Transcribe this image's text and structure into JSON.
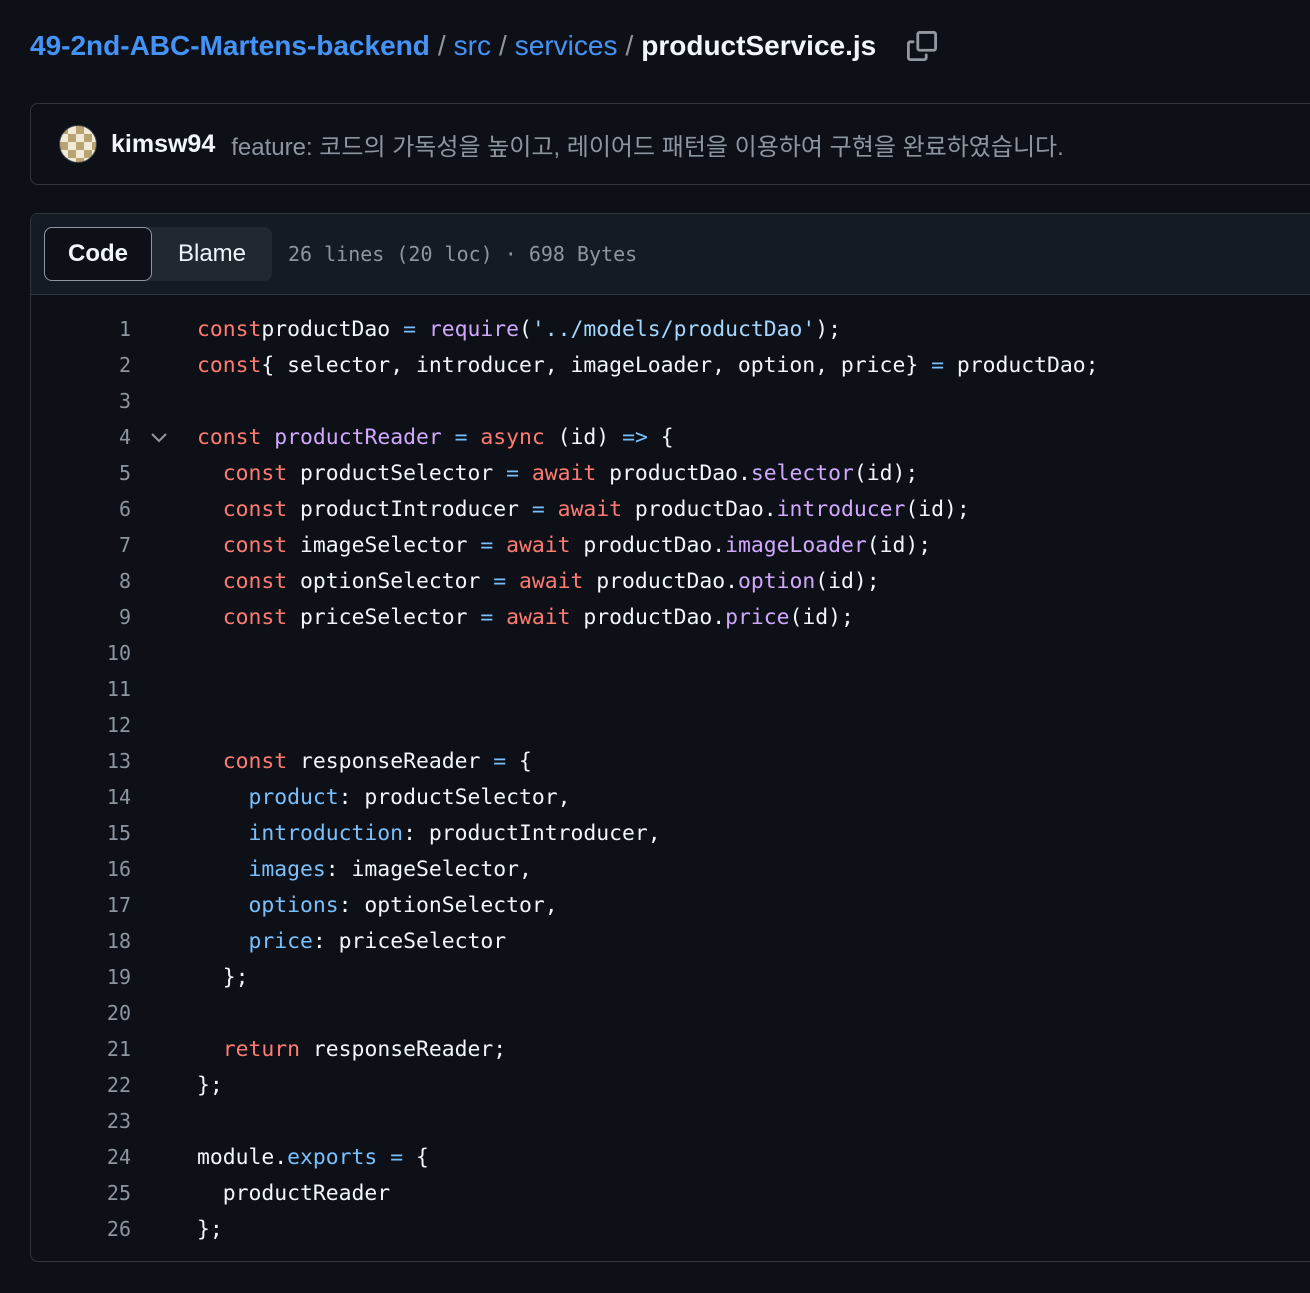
{
  "breadcrumb": {
    "repo": "49-2nd-ABC-Martens-backend",
    "separator": "/",
    "dir1": "src",
    "dir2": "services",
    "file": "productService.js"
  },
  "icons": {
    "copy": "copy-icon",
    "fold": "chevron-down-icon",
    "avatar": "avatar"
  },
  "commit": {
    "author": "kimsw94",
    "message": "feature: 코드의 가독성을 높이고, 레이어드 패턴을 이용하여 구현을 완료하였습니다."
  },
  "file": {
    "tabs": [
      {
        "label": "Code",
        "active": true
      },
      {
        "label": "Blame",
        "active": false
      }
    ],
    "meta": "26 lines (20 loc) · 698 Bytes"
  },
  "colors": {
    "background": "#0d1117",
    "link": "#4493f8",
    "keyword": "#ff7b72",
    "function": "#d2a8ff",
    "constant": "#79c0ff",
    "string": "#a5d6ff"
  },
  "code": {
    "line_numbers": [
      "1",
      "2",
      "3",
      "4",
      "5",
      "6",
      "7",
      "8",
      "9",
      "10",
      "11",
      "12",
      "13",
      "14",
      "15",
      "16",
      "17",
      "18",
      "19",
      "20",
      "21",
      "22",
      "23",
      "24",
      "25",
      "26"
    ],
    "lines": [
      [
        [
          "kw",
          "const"
        ],
        [
          "",
          "productDao "
        ],
        [
          "cn",
          "="
        ],
        [
          "",
          " "
        ],
        [
          "fn",
          "require"
        ],
        [
          "",
          "("
        ],
        [
          "st",
          "'../models/productDao'"
        ],
        [
          "",
          ");"
        ]
      ],
      [
        [
          "kw",
          "const"
        ],
        [
          "",
          "{ selector, introducer, imageLoader, option, price} "
        ],
        [
          "cn",
          "="
        ],
        [
          "",
          " productDao;"
        ]
      ],
      [],
      [
        [
          "kw",
          "const"
        ],
        [
          "",
          " "
        ],
        [
          "fn",
          "productReader"
        ],
        [
          "",
          " "
        ],
        [
          "cn",
          "="
        ],
        [
          "",
          " "
        ],
        [
          "kw",
          "async"
        ],
        [
          "",
          " (id) "
        ],
        [
          "cn",
          "=>"
        ],
        [
          "",
          " {"
        ]
      ],
      [
        [
          "",
          "  "
        ],
        [
          "kw",
          "const"
        ],
        [
          "",
          " productSelector "
        ],
        [
          "cn",
          "="
        ],
        [
          "",
          " "
        ],
        [
          "kw",
          "await"
        ],
        [
          "",
          " productDao."
        ],
        [
          "fn",
          "selector"
        ],
        [
          "",
          "(id);"
        ]
      ],
      [
        [
          "",
          "  "
        ],
        [
          "kw",
          "const"
        ],
        [
          "",
          " productIntroducer "
        ],
        [
          "cn",
          "="
        ],
        [
          "",
          " "
        ],
        [
          "kw",
          "await"
        ],
        [
          "",
          " productDao."
        ],
        [
          "fn",
          "introducer"
        ],
        [
          "",
          "(id);"
        ]
      ],
      [
        [
          "",
          "  "
        ],
        [
          "kw",
          "const"
        ],
        [
          "",
          " imageSelector "
        ],
        [
          "cn",
          "="
        ],
        [
          "",
          " "
        ],
        [
          "kw",
          "await"
        ],
        [
          "",
          " productDao."
        ],
        [
          "fn",
          "imageLoader"
        ],
        [
          "",
          "(id);"
        ]
      ],
      [
        [
          "",
          "  "
        ],
        [
          "kw",
          "const"
        ],
        [
          "",
          " optionSelector "
        ],
        [
          "cn",
          "="
        ],
        [
          "",
          " "
        ],
        [
          "kw",
          "await"
        ],
        [
          "",
          " productDao."
        ],
        [
          "fn",
          "option"
        ],
        [
          "",
          "(id);"
        ]
      ],
      [
        [
          "",
          "  "
        ],
        [
          "kw",
          "const"
        ],
        [
          "",
          " priceSelector "
        ],
        [
          "cn",
          "="
        ],
        [
          "",
          " "
        ],
        [
          "kw",
          "await"
        ],
        [
          "",
          " productDao."
        ],
        [
          "fn",
          "price"
        ],
        [
          "",
          "(id);"
        ]
      ],
      [],
      [],
      [],
      [
        [
          "",
          "  "
        ],
        [
          "kw",
          "const"
        ],
        [
          "",
          " responseReader "
        ],
        [
          "cn",
          "="
        ],
        [
          "",
          " {"
        ]
      ],
      [
        [
          "",
          "    "
        ],
        [
          "cn",
          "product"
        ],
        [
          "",
          ": productSelector,"
        ]
      ],
      [
        [
          "",
          "    "
        ],
        [
          "cn",
          "introduction"
        ],
        [
          "",
          ": productIntroducer,"
        ]
      ],
      [
        [
          "",
          "    "
        ],
        [
          "cn",
          "images"
        ],
        [
          "",
          ": imageSelector,"
        ]
      ],
      [
        [
          "",
          "    "
        ],
        [
          "cn",
          "options"
        ],
        [
          "",
          ": optionSelector,"
        ]
      ],
      [
        [
          "",
          "    "
        ],
        [
          "cn",
          "price"
        ],
        [
          "",
          ": priceSelector"
        ]
      ],
      [
        [
          "",
          "  };"
        ]
      ],
      [],
      [
        [
          "",
          "  "
        ],
        [
          "kw",
          "return"
        ],
        [
          "",
          " responseReader;"
        ]
      ],
      [
        [
          "",
          "};"
        ]
      ],
      [],
      [
        [
          "",
          "module."
        ],
        [
          "cn",
          "exports"
        ],
        [
          "",
          " "
        ],
        [
          "cn",
          "="
        ],
        [
          "",
          " {"
        ]
      ],
      [
        [
          "",
          "  productReader"
        ]
      ],
      [
        [
          "",
          "};"
        ]
      ]
    ]
  }
}
